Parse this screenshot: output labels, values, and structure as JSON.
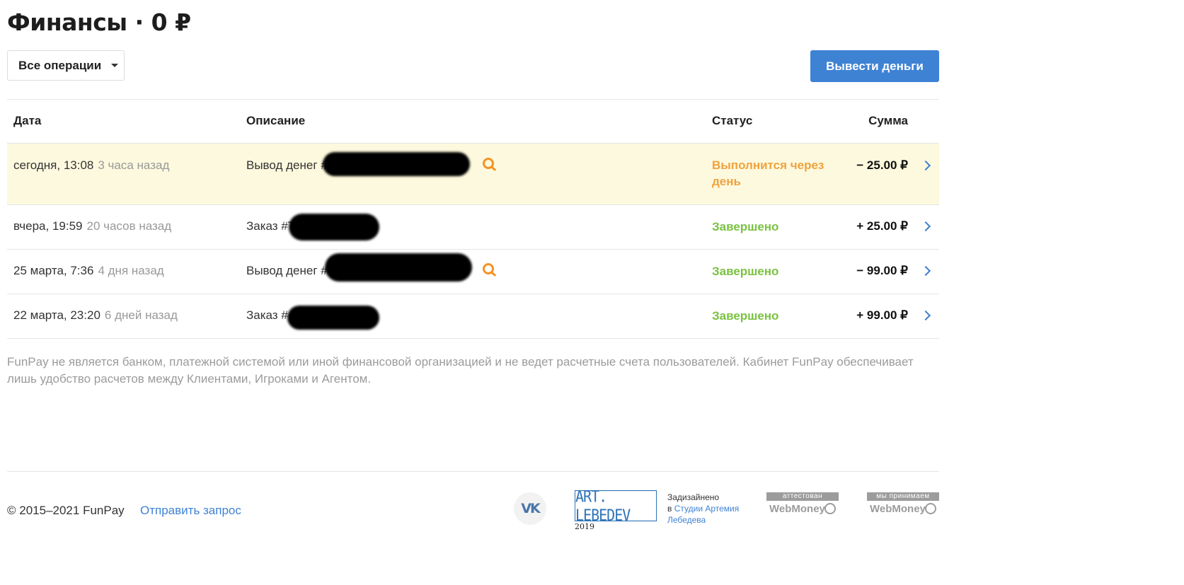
{
  "page": {
    "title": "Финансы · 0 ₽"
  },
  "filter": {
    "label": "Все операции"
  },
  "actions": {
    "withdraw_label": "Вывести деньги"
  },
  "table": {
    "headers": {
      "date": "Дата",
      "description": "Описание",
      "status": "Статус",
      "amount": "Сумма"
    },
    "rows": [
      {
        "date": "сегодня, 13:08",
        "ago": "3 часа назад",
        "description": "Вывод денег #",
        "status": "Выполнится через день",
        "status_type": "pending",
        "amount": "− 25.00 ₽",
        "method_icon": "qiwi-icon"
      },
      {
        "date": "вчера, 19:59",
        "ago": "20 часов назад",
        "description": "Заказ #T",
        "status": "Завершено",
        "status_type": "done",
        "amount": "+ 25.00 ₽"
      },
      {
        "date": "25 марта, 7:36",
        "ago": "4 дня назад",
        "description": "Вывод денег #",
        "status": "Завершено",
        "status_type": "done",
        "amount": "− 99.00 ₽",
        "method_icon": "qiwi-icon"
      },
      {
        "date": "22 марта, 23:20",
        "ago": "6 дней назад",
        "description": "Заказ #",
        "status": "Завершено",
        "status_type": "done",
        "amount": "+ 99.00 ₽"
      }
    ]
  },
  "disclaimer": "FunPay не является банком, платежной системой или иной финансовой организацией и не ведет расчетные счета пользователей. Кабинет FunPay обеспечивает лишь удобство расчетов между Клиентами, Игроками и Агентом.",
  "footer": {
    "copyright": "© 2015–2021 FunPay",
    "send_request": "Отправить запрос",
    "vk_label": "VK",
    "artlebedev_logo": "ART. LEBEDEV",
    "artlebedev_year": "2019",
    "designed_line1": "Задизайнено",
    "designed_line2": "в",
    "designed_link": "Студии Артемия Лебедева",
    "wm_attested_label": "аттестован",
    "wm_accept_label": "мы принимаем",
    "wm_name": "WebMoney"
  },
  "colors": {
    "accent": "#3e82d4",
    "pending_status": "#f0a23e",
    "done_status": "#7ac242",
    "pending_row_bg": "#fdf9de"
  }
}
